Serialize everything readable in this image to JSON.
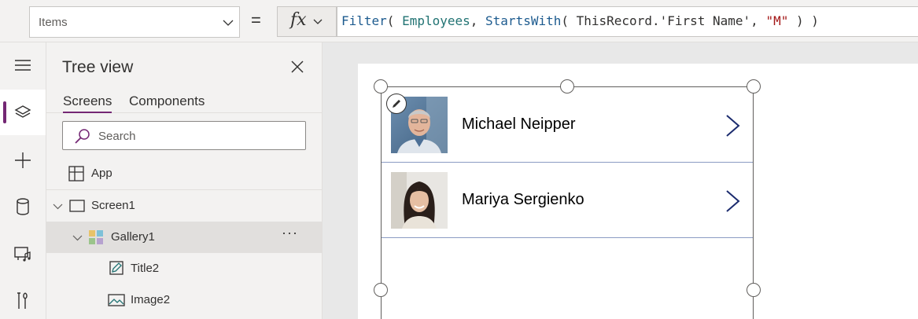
{
  "formula_bar": {
    "property": "Items",
    "equals": "=",
    "fx_label": "fx",
    "formula_tokens": [
      {
        "text": "Filter",
        "kind": "fn"
      },
      {
        "text": "( ",
        "kind": "plain"
      },
      {
        "text": "Employees",
        "kind": "id"
      },
      {
        "text": ", ",
        "kind": "plain"
      },
      {
        "text": "StartsWith",
        "kind": "fn"
      },
      {
        "text": "( ThisRecord.'First Name', ",
        "kind": "plain"
      },
      {
        "text": "\"M\"",
        "kind": "str"
      },
      {
        "text": " ) )",
        "kind": "plain"
      }
    ]
  },
  "tree_view": {
    "title": "Tree view",
    "tabs": [
      "Screens",
      "Components"
    ],
    "active_tab": "Screens",
    "search_placeholder": "Search",
    "items": [
      {
        "label": "App",
        "icon": "app-icon"
      },
      {
        "label": "Screen1",
        "icon": "screen-icon",
        "expanded": true
      },
      {
        "label": "Gallery1",
        "icon": "gallery-icon",
        "expanded": true,
        "selected": true,
        "more": "···"
      },
      {
        "label": "Title2",
        "icon": "edit-label-icon"
      },
      {
        "label": "Image2",
        "icon": "image-icon"
      }
    ]
  },
  "rail": {
    "items": [
      "hamburger-icon",
      "layers-icon",
      "plus-icon",
      "data-icon",
      "media-icon",
      "tools-icon"
    ],
    "active": "layers-icon"
  },
  "gallery": {
    "rows": [
      {
        "name": "Michael Neipper"
      },
      {
        "name": "Mariya Sergienko"
      }
    ]
  },
  "colors": {
    "accent": "#742774",
    "arrow": "#1b2b6e",
    "row_divider": "#8b9bc3"
  }
}
